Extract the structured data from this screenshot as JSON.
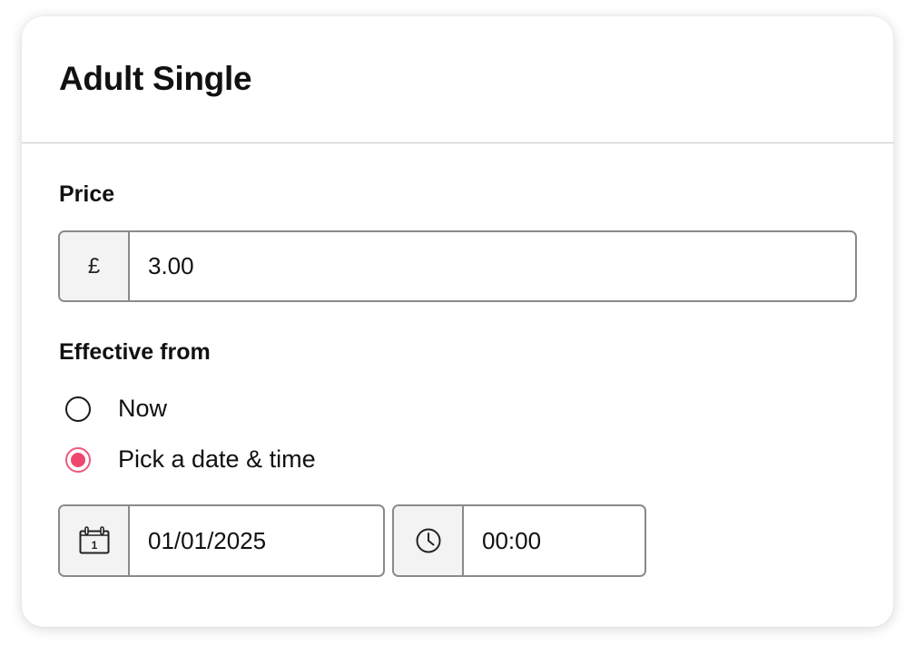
{
  "card": {
    "title": "Adult Single"
  },
  "price": {
    "label": "Price",
    "currency_symbol": "£",
    "value": "3.00"
  },
  "effective_from": {
    "label": "Effective from",
    "options": [
      {
        "label": "Now",
        "selected": false
      },
      {
        "label": "Pick a date & time",
        "selected": true
      }
    ],
    "date_value": "01/01/2025",
    "date_icon_day": "1",
    "time_value": "00:00"
  },
  "icons": {
    "date": "calendar-icon",
    "time": "clock-icon"
  },
  "colors": {
    "accent": "#f0476f",
    "border": "#8a8a8a",
    "addon_background": "#f3f3f3"
  }
}
